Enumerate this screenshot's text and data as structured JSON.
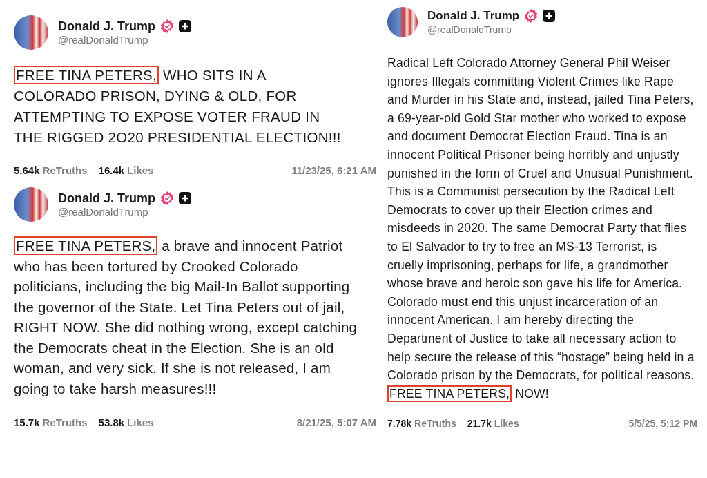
{
  "columns": [
    {
      "posts": [
        {
          "author": {
            "name": "Donald J. Trump",
            "handle": "@realDonaldTrump",
            "verified": true
          },
          "body": [
            {
              "text": "FREE TINA PETERS,",
              "highlighted": true
            },
            {
              "text": " WHO SITS IN A COLORADO PRISON, DYING & OLD, FOR ATTEMPTING TO EXPOSE VOTER FRAUD IN THE RIGGED 2O20 PRESIDENTIAL ELECTION!!!",
              "highlighted": false
            }
          ],
          "retruths": "5.64k",
          "retruths_label": "ReTruths",
          "likes": "16.4k",
          "likes_label": "Likes",
          "date": "11/23/25, 6:21 AM"
        },
        {
          "author": {
            "name": "Donald J. Trump",
            "handle": "@realDonaldTrump",
            "verified": true
          },
          "body": [
            {
              "text": "FREE TINA PETERS,",
              "highlighted": true
            },
            {
              "text": " a brave and innocent Patriot who has been tortured by Crooked Colorado politicians, including the big Mail-In Ballot supporting the governor of the State. Let Tina Peters out of jail, RIGHT NOW. She did nothing wrong, except catching the Democrats cheat in the Election. She is an old woman, and very sick. If she is not released, I am going to take harsh measures!!!",
              "highlighted": false
            }
          ],
          "retruths": "15.7k",
          "retruths_label": "ReTruths",
          "likes": "53.8k",
          "likes_label": "Likes",
          "date": "8/21/25, 5:07 AM"
        }
      ]
    },
    {
      "posts": [
        {
          "author": {
            "name": "Donald J. Trump",
            "handle": "@realDonaldTrump",
            "verified": true
          },
          "body": [
            {
              "text": "Radical Left Colorado Attorney General Phil Weiser ignores Illegals committing Violent Crimes like Rape and Murder in his State and, instead, jailed Tina Peters, a 69-year-old Gold Star mother who worked to expose and document Democrat Election Fraud. Tina is an innocent Political Prisoner being horribly and unjustly punished in the form of Cruel and Unusual Punishment. This is a Communist persecution by the Radical Left Democrats to cover up their Election crimes and misdeeds in 2020. The same Democrat Party that flies to El Salvador to try to free an MS-13 Terrorist, is cruelly imprisoning, perhaps for life, a grandmother whose brave and heroic son gave his life for America. Colorado must end this unjust incarceration of an innocent American. I am hereby directing the Department of Justice to take all necessary action to help secure the release of this “hostage” being held in a Colorado prison by the Democrats, for political reasons. ",
              "highlighted": false
            },
            {
              "text": "FREE TINA PETERS,",
              "highlighted": true
            },
            {
              "text": " NOW!",
              "highlighted": false
            }
          ],
          "retruths": "7.78k",
          "retruths_label": "ReTruths",
          "likes": "21.7k",
          "likes_label": "Likes",
          "date": "5/5/25, 5:12 PM"
        }
      ]
    }
  ]
}
